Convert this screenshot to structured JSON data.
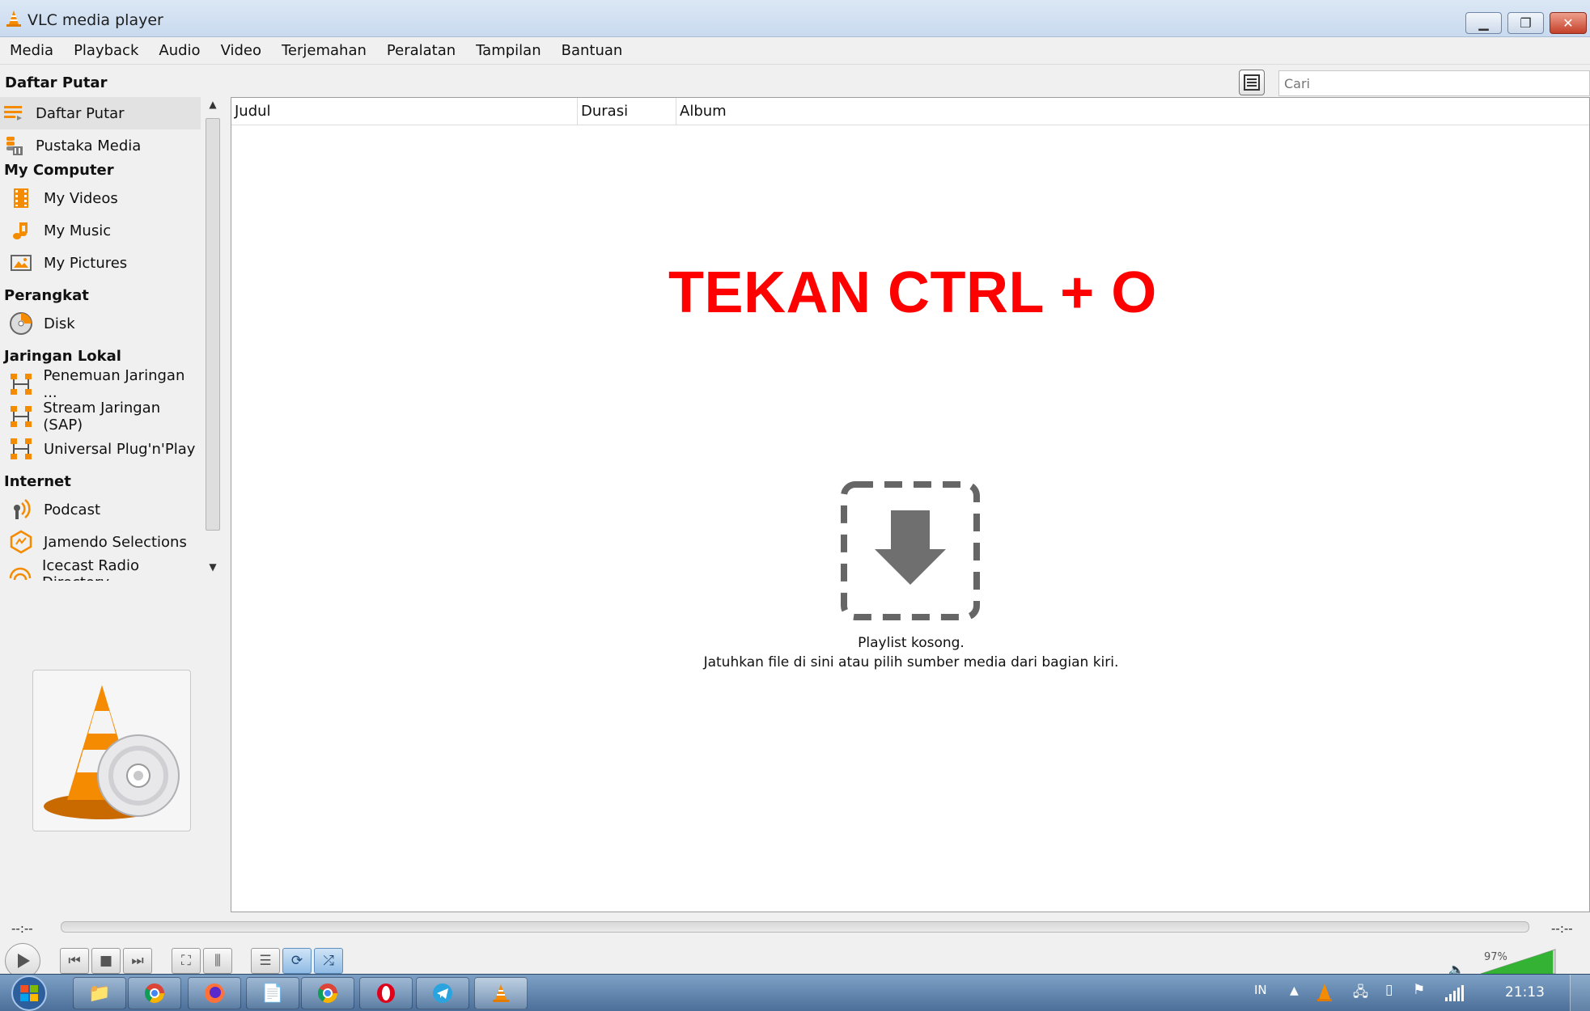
{
  "window": {
    "title": "VLC media player",
    "controls": {
      "minimize_icon": "minimize-icon",
      "maximize_icon": "restore-icon",
      "close_icon": "close-icon"
    }
  },
  "menu": [
    "Media",
    "Playback",
    "Audio",
    "Video",
    "Terjemahan",
    "Peralatan",
    "Tampilan",
    "Bantuan"
  ],
  "sidebar": {
    "header": "Daftar Putar",
    "items": [
      {
        "label": "Daftar Putar",
        "icon": "playlist-icon",
        "selected": true
      },
      {
        "label": "Pustaka Media",
        "icon": "media-library-icon"
      }
    ],
    "categories": [
      {
        "title": "My Computer",
        "items": [
          {
            "label": "My Videos",
            "icon": "film-icon"
          },
          {
            "label": "My Music",
            "icon": "music-note-icon"
          },
          {
            "label": "My Pictures",
            "icon": "picture-icon"
          }
        ]
      },
      {
        "title": "Perangkat",
        "items": [
          {
            "label": "Disk",
            "icon": "disc-icon"
          }
        ]
      },
      {
        "title": "Jaringan Lokal",
        "items": [
          {
            "label": "Penemuan Jaringan ...",
            "icon": "network-icon"
          },
          {
            "label": "Stream Jaringan (SAP)",
            "icon": "network-icon"
          },
          {
            "label": "Universal Plug'n'Play",
            "icon": "network-icon"
          }
        ]
      },
      {
        "title": "Internet",
        "items": [
          {
            "label": "Podcast",
            "icon": "podcast-icon"
          },
          {
            "label": "Jamendo Selections",
            "icon": "jamendo-icon"
          },
          {
            "label": "Icecast Radio Directory",
            "icon": "radio-icon"
          }
        ]
      }
    ],
    "art_icon": "vlc-cone-disc-icon"
  },
  "search": {
    "placeholder": "Cari"
  },
  "playlist": {
    "columns": [
      "Judul",
      "Durasi",
      "Album"
    ],
    "overlay_text": "TEKAN CTRL + O",
    "empty_title": "Playlist kosong.",
    "empty_desc": "Jatuhkan file di sini atau pilih sumber media dari bagian kiri."
  },
  "player": {
    "elapsed": "--:--",
    "remaining": "--:--",
    "volume": "97%",
    "volume_level": 0.97
  },
  "taskbar": {
    "language": "IN",
    "clock": "21:13"
  },
  "colors": {
    "overlay_red": "#ff0000",
    "vlc_orange": "#f48b00",
    "taskbar_blue": "#4b6f99"
  }
}
